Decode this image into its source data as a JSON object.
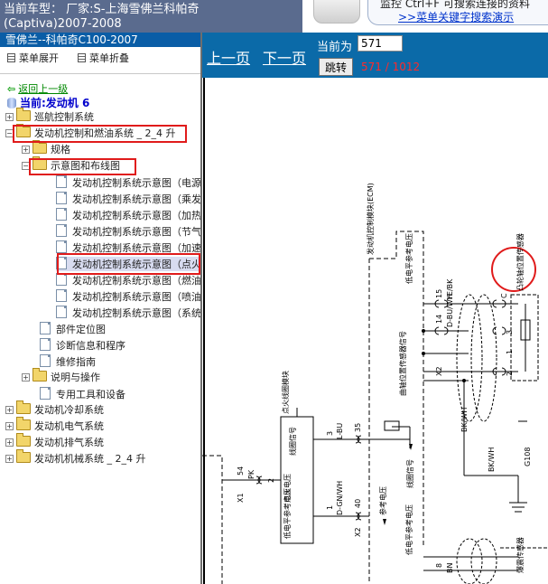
{
  "header": {
    "line1": "当前车型：  厂家:S-上海雪佛兰科帕奇",
    "line2": "(Captiva)2007-2008"
  },
  "hint": {
    "text": "监控 Ctrl+F  可搜索连接的资料",
    "link": ">>菜单关键字搜索演示"
  },
  "sidebar": {
    "model": "雪佛兰--科帕奇C100-2007",
    "expand_label": "菜单展开",
    "collapse_label": "菜单折叠",
    "back_label": "返回上一级",
    "current_label": "当前:发动机 6",
    "items": [
      {
        "label": "巡航控制系统"
      },
      {
        "label": "发动机控制和燃油系统 _ 2_4 升"
      },
      {
        "label": "规格"
      },
      {
        "label": "示意图和布线图"
      },
      {
        "label": "发动机控制系统示意图（电源"
      },
      {
        "label": "发动机控制系统示意图（乘发"
      },
      {
        "label": "发动机控制系统示意图（加热"
      },
      {
        "label": "发动机控制系统示意图（节气"
      },
      {
        "label": "发动机控制系统示意图（加速"
      },
      {
        "label": "发动机控制系统示意图（点火"
      },
      {
        "label": "发动机控制系统示意图（燃油"
      },
      {
        "label": "发动机控制系统示意图（喷油"
      },
      {
        "label": "发动机控制系统示意图（系统"
      },
      {
        "label": "部件定位图"
      },
      {
        "label": "诊断信息和程序"
      },
      {
        "label": "维修指南"
      },
      {
        "label": "说明与操作"
      },
      {
        "label": "专用工具和设备"
      },
      {
        "label": "发动机冷却系统"
      },
      {
        "label": "发动机电气系统"
      },
      {
        "label": "发动机排气系统"
      },
      {
        "label": "发动机机械系统 _ 2_4 升"
      }
    ]
  },
  "nav": {
    "prev": "上一页",
    "next": "下一页",
    "current_label": "当前为",
    "page_value": "571",
    "jump": "跳转",
    "page_count": "571 / 1012"
  },
  "diagram": {
    "ecm_label": "发动机控制模块(ECM)",
    "sensor_label": "凸轮轴位置传感器",
    "ref_voltage_top": "低电平参考电压",
    "pin15": "15",
    "wire_ye_bk": "YE/BK",
    "pin14": "14",
    "wire_d_bu_wh": "D-BU/WH",
    "x2_a": "X2",
    "pin3": "3",
    "crank_signal": "曲轴位置传感器信号",
    "coil_module": "点火线圈模块",
    "coil_signal": "线圈信号",
    "l_bu": "L-BU",
    "pin35": "35",
    "ign_voltage": "点火电压",
    "pin54": "54",
    "pk": "PK",
    "pin2": "2",
    "x1": "X1",
    "coil_ref": "低电平参考电压",
    "d_gn_wh": "D-GN/WH",
    "pin40": "40",
    "x2_b": "X2",
    "pin1": "1",
    "ref_voltage_bot": "参考电压",
    "coil_signal2": "线圈信号",
    "bk_wh_1": "BK/WH",
    "bk_wh_2": "BK/WH",
    "g108": "G108",
    "bn": "BN",
    "pin8": "8",
    "sensor_bottom": "爆震传感器",
    "c_pin1": "1",
    "c_pin2": "2",
    "c_pin3": "3",
    "c_pinc": "C"
  },
  "colors": {
    "nav_bg": "#0b6aa8",
    "model_bar": "#0a5da6",
    "header_bg": "#5a6b8e",
    "highlight_box": "#e01b1b",
    "page_count": "#ff2a2a"
  }
}
